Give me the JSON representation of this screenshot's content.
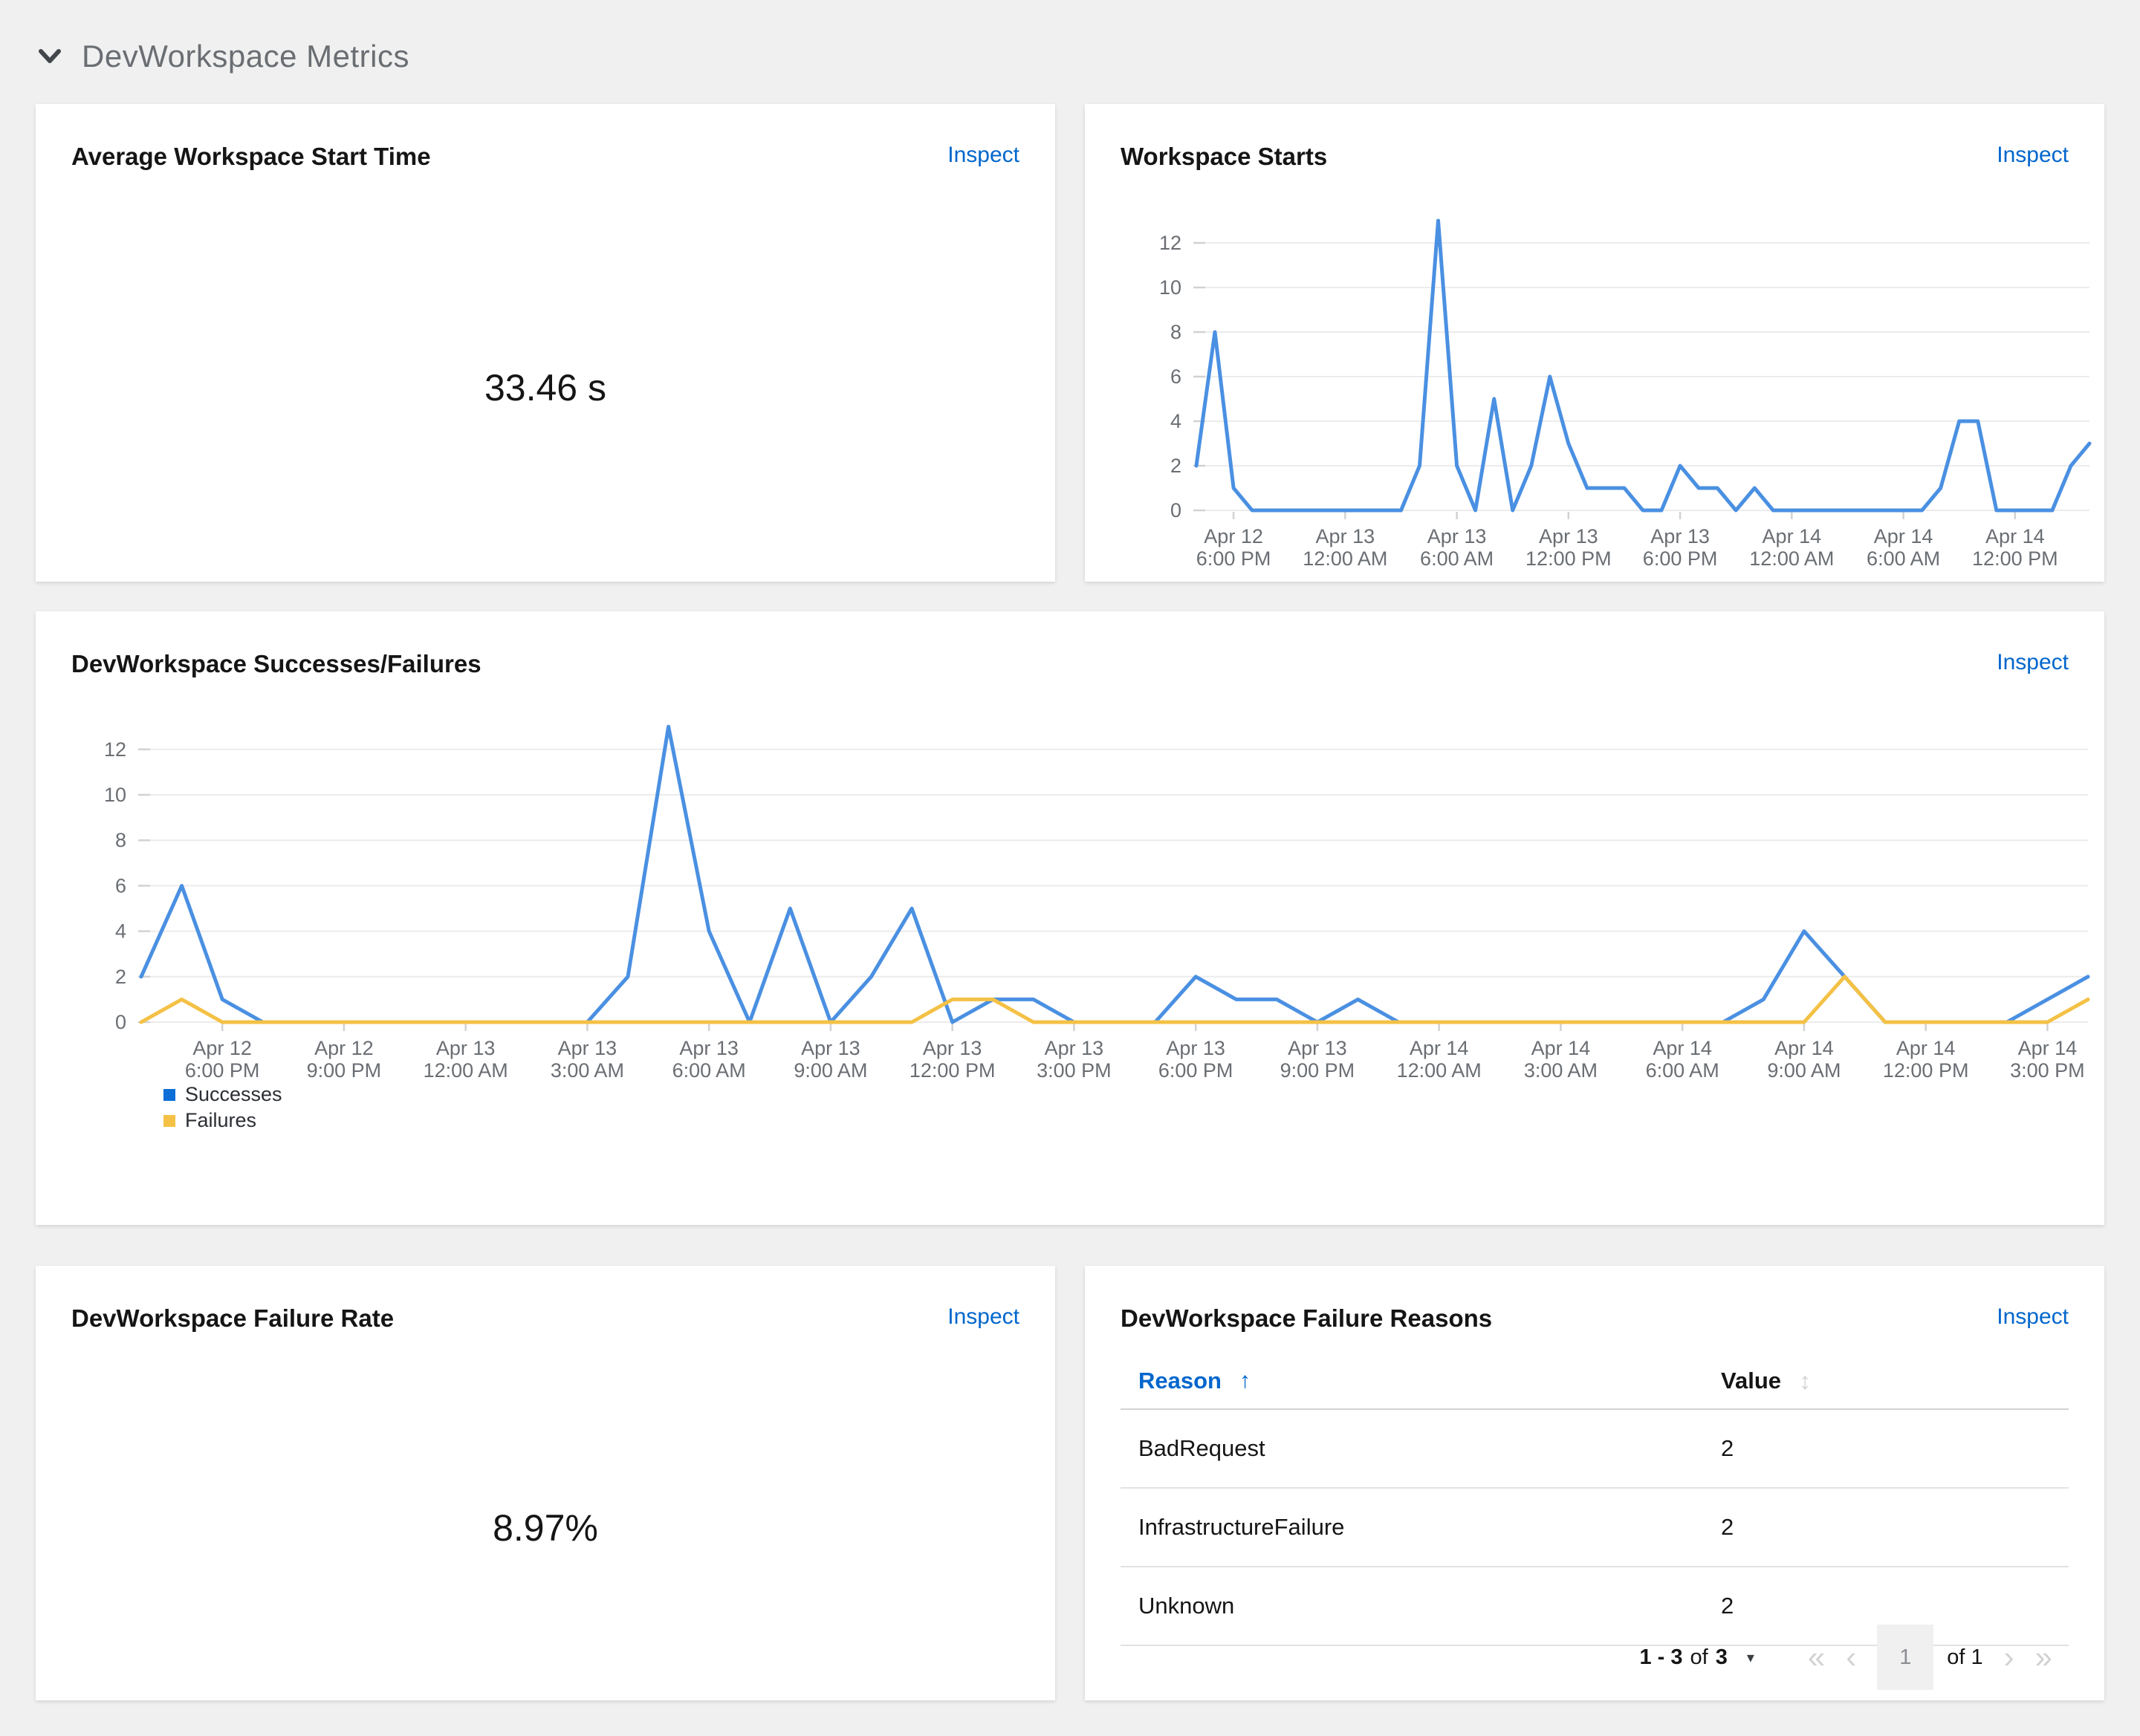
{
  "section": {
    "title": "DevWorkspace Metrics"
  },
  "labels": {
    "inspect": "Inspect",
    "sort_asc_icon": "↑",
    "sort_icon": "↕",
    "caret_icon": "▾",
    "first_icon": "«",
    "prev_icon": "‹",
    "next_icon": "›",
    "last_icon": "»"
  },
  "colors": {
    "background": "#f0f0f0",
    "card": "#ffffff",
    "link_blue": "#0066cc",
    "chart_blue": "#4a90e2",
    "chart_gold": "#f4c145",
    "legend_blue": "#0d6ed7",
    "axis_text": "#6a6e73",
    "gridline": "#ececec"
  },
  "cards": {
    "avg_start_time": {
      "title": "Average Workspace Start Time",
      "value": "33.46 s"
    },
    "workspace_starts": {
      "title": "Workspace Starts"
    },
    "successes_failures": {
      "title": "DevWorkspace Successes/Failures"
    },
    "failure_rate": {
      "title": "DevWorkspace Failure Rate",
      "value": "8.97%"
    },
    "failure_reasons": {
      "title": "DevWorkspace Failure Reasons"
    }
  },
  "chart_data": [
    {
      "id": "workspace-starts",
      "type": "line",
      "title": "Workspace Starts",
      "xlabel": "",
      "ylabel": "",
      "x_start": "Apr 12 4:00 PM",
      "x_end": "Apr 14 4:00 PM",
      "x_step_hours": 1,
      "n_points": 49,
      "ylim": [
        0,
        13.5
      ],
      "y_ticks": [
        0,
        2,
        4,
        6,
        8,
        10,
        12
      ],
      "grid": true,
      "legend_position": "none",
      "x_ticks": [
        {
          "i": 2,
          "line1": "Apr 12",
          "line2": "6:00 PM"
        },
        {
          "i": 8,
          "line1": "Apr 13",
          "line2": "12:00 AM"
        },
        {
          "i": 14,
          "line1": "Apr 13",
          "line2": "6:00 AM"
        },
        {
          "i": 20,
          "line1": "Apr 13",
          "line2": "12:00 PM"
        },
        {
          "i": 26,
          "line1": "Apr 13",
          "line2": "6:00 PM"
        },
        {
          "i": 32,
          "line1": "Apr 14",
          "line2": "12:00 AM"
        },
        {
          "i": 38,
          "line1": "Apr 14",
          "line2": "6:00 AM"
        },
        {
          "i": 44,
          "line1": "Apr 14",
          "line2": "12:00 PM"
        }
      ],
      "series": [
        {
          "name": "Workspace Starts",
          "color": "#4a90e2",
          "values": [
            2,
            8,
            1,
            0,
            0,
            0,
            0,
            0,
            0,
            0,
            0,
            0,
            2,
            13,
            2,
            0,
            5,
            0,
            2,
            6,
            3,
            1,
            1,
            1,
            0,
            0,
            2,
            1,
            1,
            0,
            1,
            0,
            0,
            0,
            0,
            0,
            0,
            0,
            0,
            0,
            1,
            4,
            4,
            0,
            0,
            0,
            0,
            2,
            3
          ]
        }
      ]
    },
    {
      "id": "successes-failures",
      "type": "line",
      "title": "DevWorkspace Successes/Failures",
      "xlabel": "",
      "ylabel": "",
      "x_start": "Apr 12 4:00 PM",
      "x_end": "Apr 14 4:00 PM",
      "x_step_hours": 1,
      "n_points": 49,
      "ylim": [
        0,
        13.5
      ],
      "y_ticks": [
        0,
        2,
        4,
        6,
        8,
        10,
        12
      ],
      "grid": true,
      "legend_position": "bottom-left",
      "x_ticks": [
        {
          "i": 2,
          "line1": "Apr 12",
          "line2": "6:00 PM"
        },
        {
          "i": 5,
          "line1": "Apr 12",
          "line2": "9:00 PM"
        },
        {
          "i": 8,
          "line1": "Apr 13",
          "line2": "12:00 AM"
        },
        {
          "i": 11,
          "line1": "Apr 13",
          "line2": "3:00 AM"
        },
        {
          "i": 14,
          "line1": "Apr 13",
          "line2": "6:00 AM"
        },
        {
          "i": 17,
          "line1": "Apr 13",
          "line2": "9:00 AM"
        },
        {
          "i": 20,
          "line1": "Apr 13",
          "line2": "12:00 PM"
        },
        {
          "i": 23,
          "line1": "Apr 13",
          "line2": "3:00 PM"
        },
        {
          "i": 26,
          "line1": "Apr 13",
          "line2": "6:00 PM"
        },
        {
          "i": 29,
          "line1": "Apr 13",
          "line2": "9:00 PM"
        },
        {
          "i": 32,
          "line1": "Apr 14",
          "line2": "12:00 AM"
        },
        {
          "i": 35,
          "line1": "Apr 14",
          "line2": "3:00 AM"
        },
        {
          "i": 38,
          "line1": "Apr 14",
          "line2": "6:00 AM"
        },
        {
          "i": 41,
          "line1": "Apr 14",
          "line2": "9:00 AM"
        },
        {
          "i": 44,
          "line1": "Apr 14",
          "line2": "12:00 PM"
        },
        {
          "i": 47,
          "line1": "Apr 14",
          "line2": "3:00 PM"
        }
      ],
      "series": [
        {
          "name": "Successes",
          "color": "#4a90e2",
          "legend_color": "#0d6ed7",
          "values": [
            2,
            6,
            1,
            0,
            0,
            0,
            0,
            0,
            0,
            0,
            0,
            0,
            2,
            13,
            4,
            0,
            5,
            0,
            2,
            5,
            0,
            1,
            1,
            0,
            0,
            0,
            2,
            1,
            1,
            0,
            1,
            0,
            0,
            0,
            0,
            0,
            0,
            0,
            0,
            0,
            1,
            4,
            2,
            0,
            0,
            0,
            0,
            1,
            2
          ]
        },
        {
          "name": "Failures",
          "color": "#f4c145",
          "legend_color": "#f4c145",
          "values": [
            0,
            1,
            0,
            0,
            0,
            0,
            0,
            0,
            0,
            0,
            0,
            0,
            0,
            0,
            0,
            0,
            0,
            0,
            0,
            0,
            1,
            1,
            0,
            0,
            0,
            0,
            0,
            0,
            0,
            0,
            0,
            0,
            0,
            0,
            0,
            0,
            0,
            0,
            0,
            0,
            0,
            0,
            2,
            0,
            0,
            0,
            0,
            0,
            1
          ]
        }
      ]
    }
  ],
  "failure_reasons_table": {
    "columns": [
      "Reason",
      "Value"
    ],
    "sorted_by": "Reason",
    "sort_direction": "ascending",
    "rows": [
      {
        "reason": "BadRequest",
        "value": "2"
      },
      {
        "reason": "InfrastructureFailure",
        "value": "2"
      },
      {
        "reason": "Unknown",
        "value": "2"
      }
    ],
    "pagination": {
      "range": "1 - 3",
      "of_word": "of",
      "total": "3",
      "page": "1",
      "of_pages": "of 1"
    }
  }
}
